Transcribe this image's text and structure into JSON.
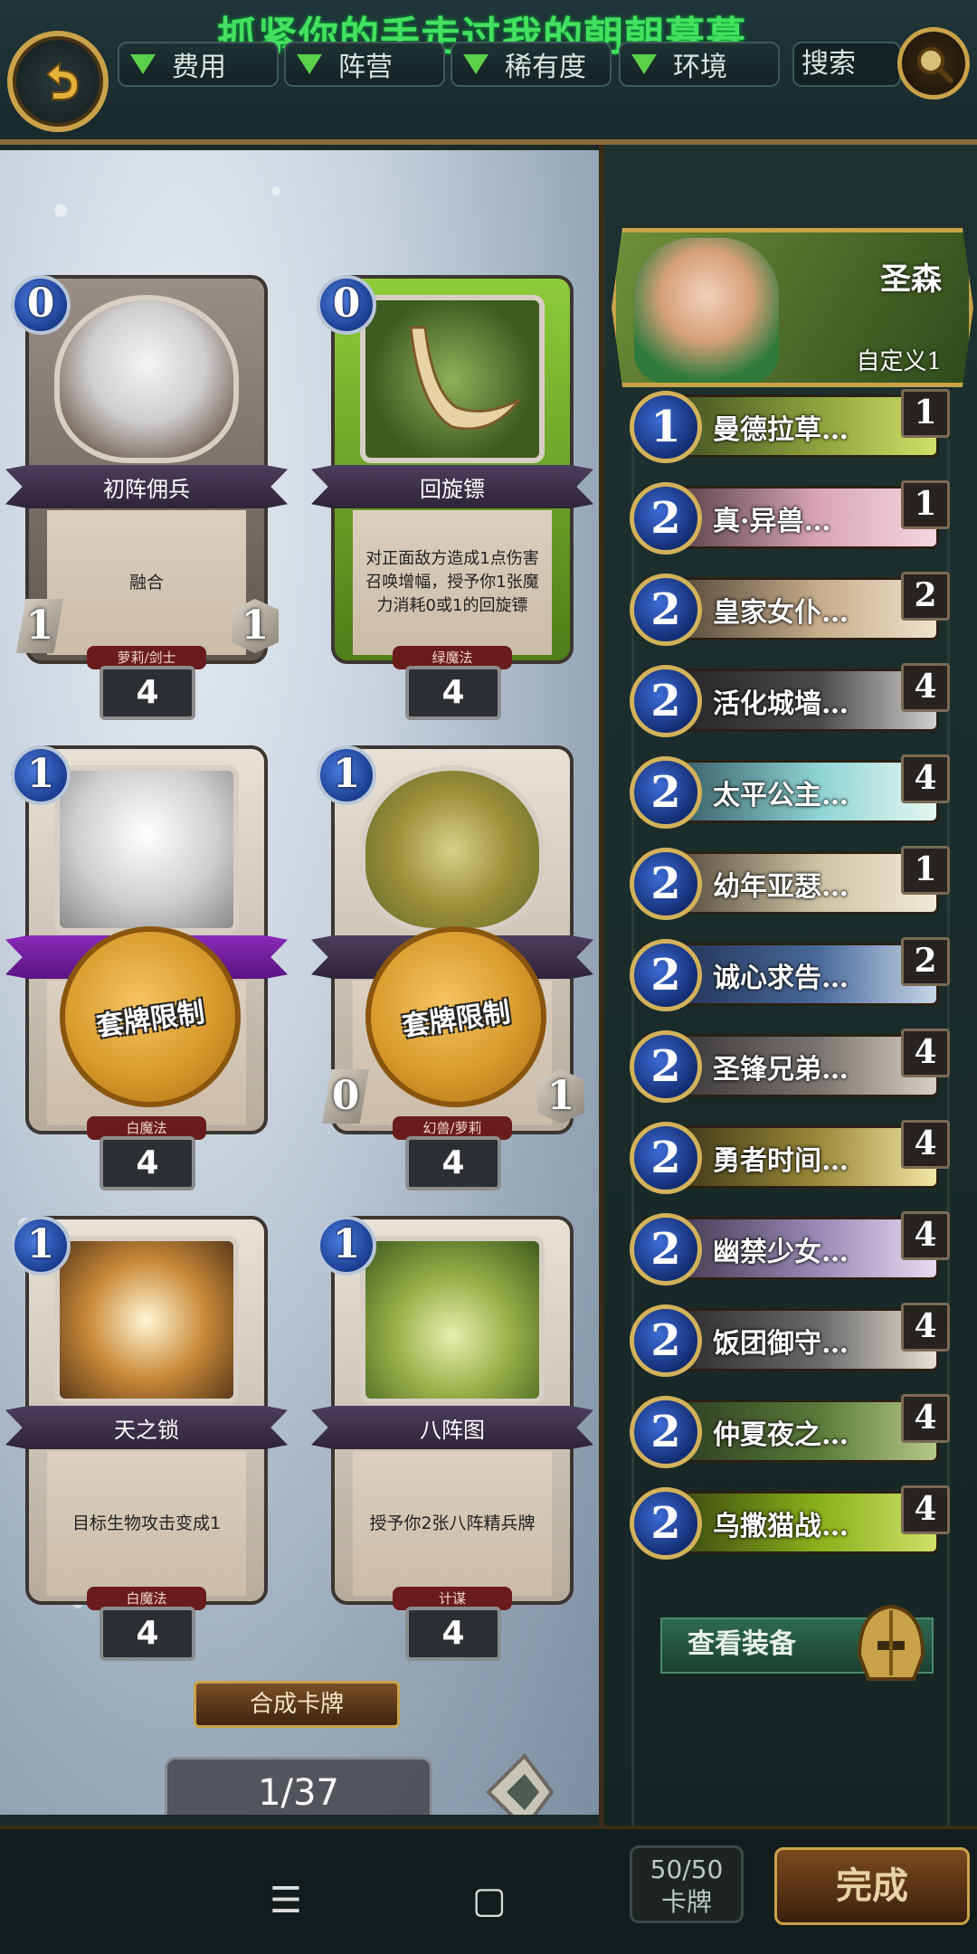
{
  "top": {
    "marquee": "抓紧你的手走过我的朝朝暮暮",
    "filters": [
      "费用",
      "阵营",
      "稀有度",
      "环境"
    ],
    "search_label": "搜索"
  },
  "cards": [
    {
      "name": "初阵佣兵",
      "desc": "融合",
      "tag": "萝莉/剑士",
      "mana": "0",
      "count": "4",
      "atk": "1",
      "hp": "1",
      "color": "#7f756c",
      "locked": false
    },
    {
      "name": "回旋镖",
      "desc": "对正面敌方造成1点伤害\n召唤增幅，授予你1张魔力消耗0或1的回旋镖",
      "tag": "绿魔法",
      "mana": "0",
      "count": "4",
      "color": "#7fbf2e",
      "locked": false
    },
    {
      "name": "",
      "desc": "",
      "tag": "白魔法",
      "mana": "1",
      "count": "4",
      "locked": true,
      "seal_text": "套牌限制"
    },
    {
      "name": "",
      "desc": "",
      "tag": "幻兽/萝莉",
      "mana": "1",
      "count": "4",
      "atk": "0",
      "hp": "1",
      "locked": true,
      "seal_text": "套牌限制"
    },
    {
      "name": "天之锁",
      "desc": "目标生物攻击变成1",
      "tag": "白魔法",
      "mana": "1",
      "count": "4",
      "locked": false
    },
    {
      "name": "八阵图",
      "desc": "授予你2张八阵精兵牌",
      "tag": "计谋",
      "mana": "1",
      "count": "4",
      "locked": false
    }
  ],
  "synth_button": "合成卡牌",
  "page_indicator": "1/37",
  "deck": {
    "name": "圣森",
    "subtitle": "自定义1",
    "items": [
      {
        "cost": "1",
        "name": "曼德拉草…",
        "qty": "1"
      },
      {
        "cost": "2",
        "name": "真·异兽…",
        "qty": "1"
      },
      {
        "cost": "2",
        "name": "皇家女仆…",
        "qty": "2"
      },
      {
        "cost": "2",
        "name": "活化城墙…",
        "qty": "4"
      },
      {
        "cost": "2",
        "name": "太平公主…",
        "qty": "4"
      },
      {
        "cost": "2",
        "name": "幼年亚瑟…",
        "qty": "1"
      },
      {
        "cost": "2",
        "name": "诚心求告…",
        "qty": "2"
      },
      {
        "cost": "2",
        "name": "圣锋兄弟…",
        "qty": "4"
      },
      {
        "cost": "2",
        "name": "勇者时间…",
        "qty": "4"
      },
      {
        "cost": "2",
        "name": "幽禁少女…",
        "qty": "4"
      },
      {
        "cost": "2",
        "name": "饭团御守…",
        "qty": "4"
      },
      {
        "cost": "2",
        "name": "仲夏夜之…",
        "qty": "4"
      },
      {
        "cost": "2",
        "name": "乌撒猫战…",
        "qty": "4"
      }
    ],
    "view_equipment": "查看装备",
    "count_value": "50/50",
    "count_label": "卡牌",
    "done_button": "完成"
  },
  "nav": {
    "menu": "☰",
    "home": "▢",
    "back": "‹"
  }
}
